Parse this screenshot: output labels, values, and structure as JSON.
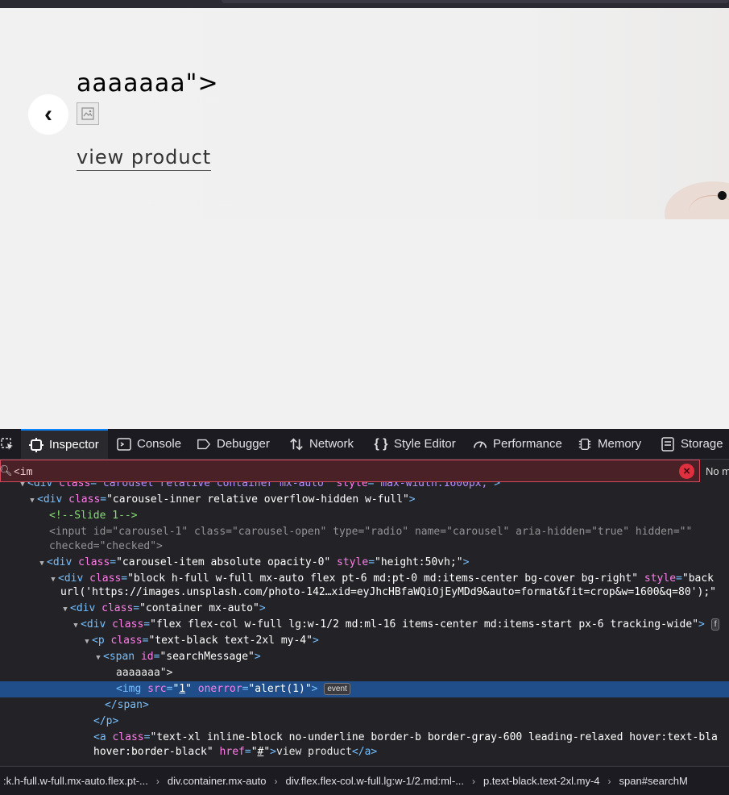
{
  "page": {
    "message": "aaaaaaa\">",
    "prev_label": "‹",
    "view_link": "view product"
  },
  "devtools": {
    "tabs": [
      {
        "label": "Inspector",
        "icon": "inspector-icon"
      },
      {
        "label": "Console",
        "icon": "console-icon"
      },
      {
        "label": "Debugger",
        "icon": "debugger-icon"
      },
      {
        "label": "Network",
        "icon": "network-icon"
      },
      {
        "label": "Style Editor",
        "icon": "style-editor-icon"
      },
      {
        "label": "Performance",
        "icon": "performance-icon"
      },
      {
        "label": "Memory",
        "icon": "memory-icon"
      },
      {
        "label": "Storage",
        "icon": "storage-icon"
      }
    ],
    "search_value": "<im",
    "no_match": "No m",
    "breadcrumbs": [
      ":k.h-full.w-full.mx-auto.flex.pt-...",
      "div.container.mx-auto",
      "div.flex.flex-col.w-full.lg:w-1/2.md:ml-...",
      "p.text-black.text-2xl.my-4",
      "span#searchM"
    ],
    "event_badge": "event"
  },
  "colors": {
    "accent": "#0a84ff",
    "selected_row": "#204e8a",
    "search_error_bg": "#4a2126",
    "tag": "#75bfff",
    "attribute": "#ff7de9",
    "comment": "#86de74"
  }
}
